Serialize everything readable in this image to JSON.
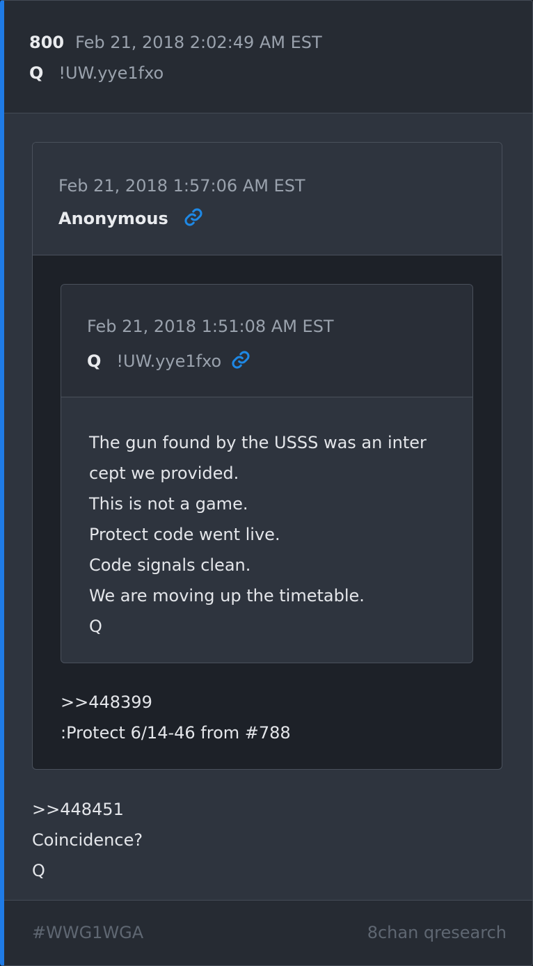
{
  "post": {
    "number": "800",
    "date": "Feb 21, 2018 2:02:49 AM EST",
    "author": "Q",
    "trip": "!UW.yye1fxo",
    "body_lines": [
      ">>448451",
      "Coincidence?",
      "Q"
    ]
  },
  "quote_outer": {
    "date": "Feb 21, 2018 1:57:06 AM EST",
    "author": "Anonymous",
    "link_icon": "link-icon",
    "body_lines": [
      ">>448399",
      ":Protect 6/14-46 from #788"
    ]
  },
  "quote_inner": {
    "date": "Feb 21, 2018 1:51:08 AM EST",
    "author": "Q",
    "trip": "!UW.yye1fxo",
    "link_icon": "link-icon",
    "body_lines": [
      "The gun found by the USSS was an inter",
      "cept we provided.",
      "This is not a game.",
      "Protect code went live.",
      "Code signals clean.",
      "We are moving up the timetable.",
      "Q"
    ]
  },
  "footer": {
    "hashtag": "#WWG1WGA",
    "source": "8chan qresearch"
  },
  "colors": {
    "accent": "#1f7be6",
    "link": "#1e88e5",
    "background": "#2e343e"
  }
}
